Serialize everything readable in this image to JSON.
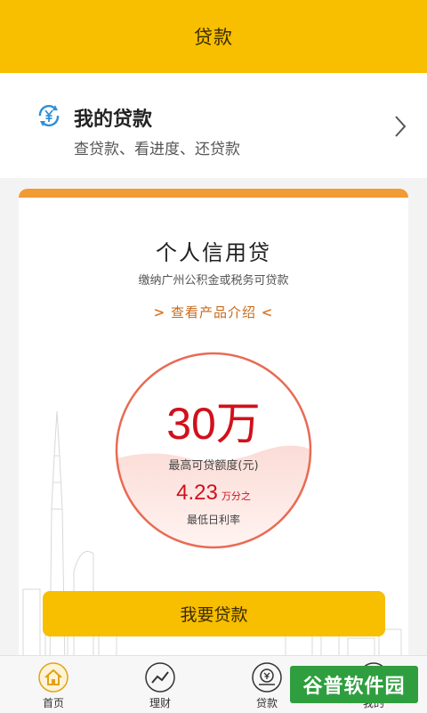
{
  "header": {
    "title": "贷款"
  },
  "my_loans": {
    "title": "我的贷款",
    "subtitle": "查贷款、看进度、还贷款",
    "icon": "yuan-refresh-icon",
    "chevron": "chevron-right-icon"
  },
  "product": {
    "title": "个人信用贷",
    "subtitle": "缴纳广州公积金或税务可贷款",
    "intro_link": "查看产品介绍",
    "amount": "30万",
    "amount_label": "最高可贷额度(元)",
    "rate_value": "4.23",
    "rate_unit": "万分之",
    "rate_label": "最低日利率",
    "cta": "我要贷款"
  },
  "tabs": [
    {
      "label": "首页",
      "icon": "home-icon",
      "active": true
    },
    {
      "label": "理财",
      "icon": "chart-trend-icon",
      "active": false
    },
    {
      "label": "贷款",
      "icon": "loan-coin-icon",
      "active": false
    },
    {
      "label": "我的",
      "icon": "user-icon",
      "active": false
    }
  ],
  "watermark": "谷普软件园",
  "colors": {
    "accent_yellow": "#f8be00",
    "accent_orange": "#f29a33",
    "amount_red": "#d0111b",
    "link_orange": "#c66a1c"
  }
}
